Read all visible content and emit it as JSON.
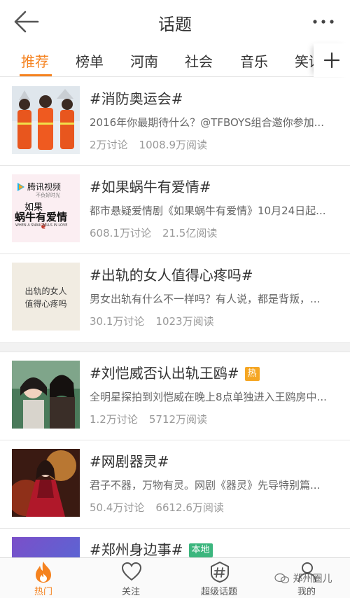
{
  "header": {
    "title": "话题",
    "back_icon": "back-arrow-icon",
    "more_icon": "more-dots-icon"
  },
  "tabs": [
    {
      "label": "推荐",
      "active": true
    },
    {
      "label": "榜单",
      "active": false
    },
    {
      "label": "河南",
      "active": false
    },
    {
      "label": "社会",
      "active": false
    },
    {
      "label": "音乐",
      "active": false
    },
    {
      "label": "笑话",
      "active": false
    }
  ],
  "tab_add_icon": "plus-icon",
  "accent_color": "#f5821f",
  "topics": [
    {
      "title": "#消防奥运会#",
      "desc": "2016年你最期待什么？@TFBOYS组合邀你参加...",
      "discuss": "2万讨论",
      "reads": "1008.9万阅读"
    },
    {
      "title": "#如果蜗牛有爱情#",
      "desc": "都市悬疑爱情剧《如果蜗牛有爱情》10月24日起...",
      "discuss": "608.1万讨论",
      "reads": "21.5亿阅读",
      "thumb": {
        "logo": "腾讯视频",
        "slogan": "不负好时光",
        "title_line1": "如果",
        "title_line2": "蜗牛有爱情",
        "english": "WHEN A SNAIL FALLS IN LOVE"
      }
    },
    {
      "title": "#出轨的女人值得心疼吗#",
      "desc": "男女出轨有什么不一样吗？有人说，都是背叛，...",
      "discuss": "30.1万讨论",
      "reads": "1023万阅读",
      "thumb": {
        "line1": "出轨的女人",
        "line2": "值得心疼吗"
      }
    },
    {
      "title": "#刘恺威否认出轨王鸥#",
      "badge": "热",
      "desc": "全明星探拍到刘恺威在晚上8点单独进入王鸥房中...",
      "discuss": "1.2万讨论",
      "reads": "5712万阅读"
    },
    {
      "title": "#网剧器灵#",
      "desc": "君子不器，万物有灵。网剧《器灵》先导特别篇...",
      "discuss": "50.4万讨论",
      "reads": "6612.6万阅读"
    },
    {
      "title": "#郑州身边事#",
      "badge": "本地"
    }
  ],
  "bottom_nav": [
    {
      "label": "热门",
      "icon": "flame-icon",
      "active": true
    },
    {
      "label": "关注",
      "icon": "heart-icon",
      "active": false
    },
    {
      "label": "超级话题",
      "icon": "hashtag-shield-icon",
      "active": false
    },
    {
      "label": "我的",
      "icon": "profile-icon",
      "active": false
    }
  ],
  "watermark": "郑州圈儿"
}
